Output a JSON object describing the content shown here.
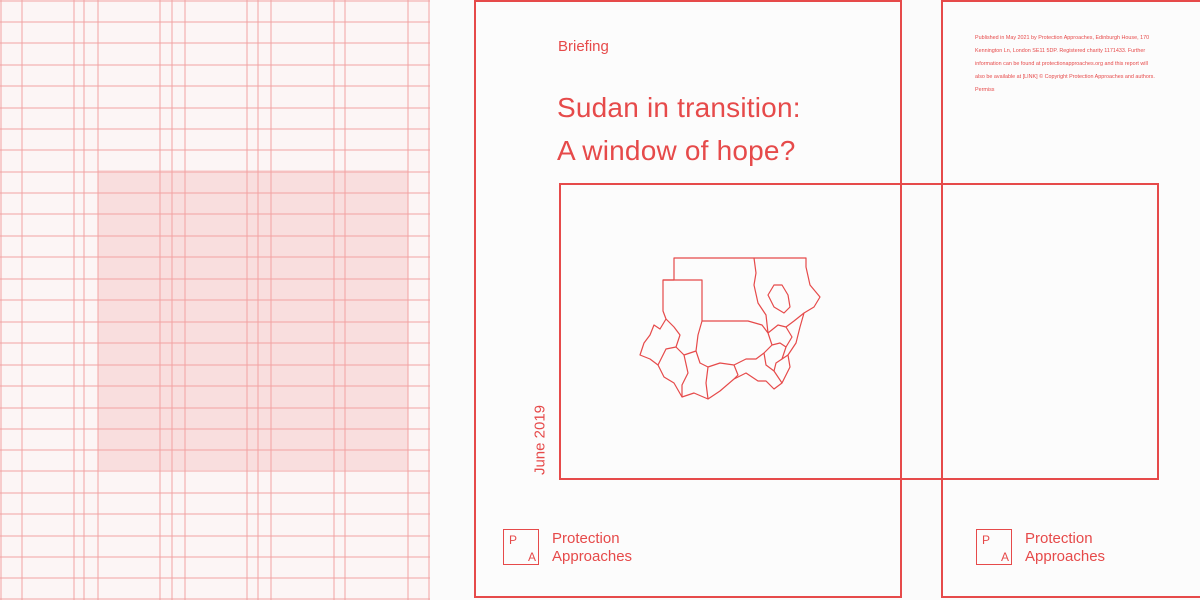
{
  "front_cover": {
    "briefing": "Briefing",
    "title_line1": "Sudan in transition:",
    "title_line2": "A window of hope?",
    "date": "June 2019",
    "logo_p": "P",
    "logo_a": "A",
    "publisher_line1": "Protection",
    "publisher_line2": "Approaches"
  },
  "back_cover": {
    "publication_note": "Published in May 2021 by Protection Approaches, Edinburgh House, 170 Kennington Ln, London SE11 5DP. Registered charity 1171433. Further information can be found at protectionapproaches.org and this report will also be available at [LINK] © Copyright Protection Approaches and authors. Permiss",
    "logo_p": "P",
    "logo_a": "A",
    "publisher_line1": "Protection",
    "publisher_line2": "Approaches"
  },
  "colors": {
    "accent": "#e64a4a",
    "grid_line": "#f4a9a9",
    "grid_fill": "#f9dede"
  }
}
